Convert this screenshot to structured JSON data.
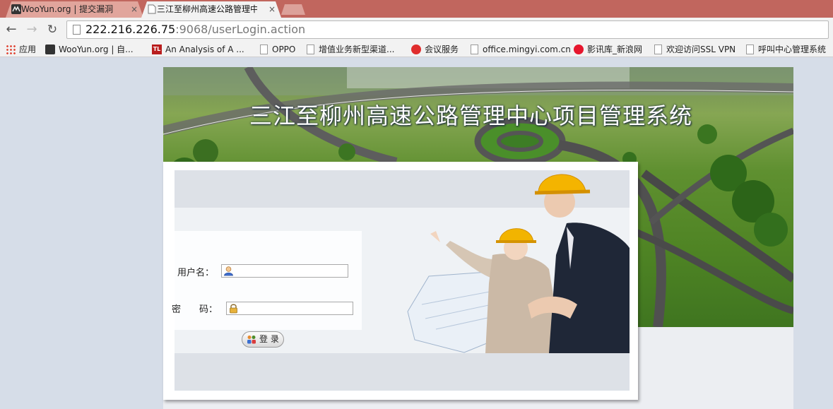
{
  "browser": {
    "tabs": [
      {
        "label": "WooYun.org | 提交漏洞",
        "active": false
      },
      {
        "label": "三江至柳州高速公路管理中心",
        "active": true
      }
    ],
    "close_glyph": "×",
    "url_host": "222.216.226.75",
    "url_rest": ":9068/userLogin.action",
    "nav": {
      "back": "←",
      "forward": "→",
      "reload": "↻"
    },
    "bookmarks": [
      {
        "label": "应用",
        "icon": "apps-grid-icon"
      },
      {
        "label": "WooYun.org | 自...",
        "icon": "wooyun-icon"
      },
      {
        "label": "An Analysis of A ...",
        "icon": "tl-logo-icon",
        "icon_text": "TL"
      },
      {
        "label": "OPPO",
        "icon": "page-icon"
      },
      {
        "label": "增值业务新型渠道...",
        "icon": "page-icon"
      },
      {
        "label": "会议服务",
        "icon": "red-circle-icon"
      },
      {
        "label": "office.mingyi.com.cn",
        "icon": "page-icon"
      },
      {
        "label": "影讯库_新浪网",
        "icon": "weibo-icon"
      },
      {
        "label": "欢迎访问SSL VPN",
        "icon": "page-icon"
      },
      {
        "label": "呼叫中心管理系统",
        "icon": "page-icon"
      }
    ]
  },
  "page": {
    "title": "三江至柳州高速公路管理中心项目管理系统",
    "login": {
      "username_label": "用户名：",
      "password_label": "密　　码：",
      "username_value": "",
      "password_value": "",
      "submit_label": "登 录",
      "user_icon": "user-icon",
      "lock_icon": "lock-icon",
      "button_icon": "users-icon"
    }
  },
  "colors": {
    "tabstrip": "#c1665e",
    "page_background": "#d6dde8",
    "banner_green": "#4f8424"
  }
}
